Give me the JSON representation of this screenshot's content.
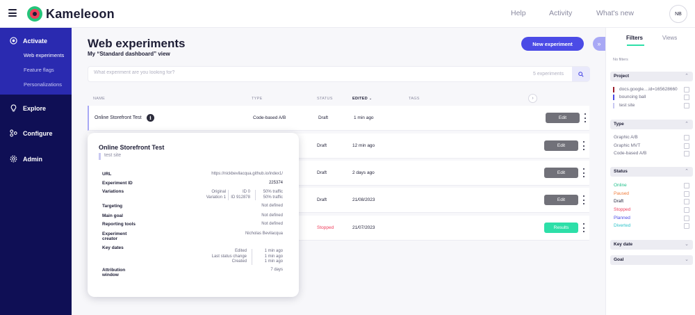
{
  "app": {
    "brand": "Kameleoon",
    "accent": "#4b4be6",
    "green": "#2ddfa8"
  },
  "topbar": {
    "help": "Help",
    "activity": "Activity",
    "whats_new": "What's new",
    "avatar": "NB"
  },
  "sidebar": {
    "activate": "Activate",
    "activate_items": [
      "Web experiments",
      "Feature flags",
      "Personalizations"
    ],
    "explore": "Explore",
    "configure": "Configure",
    "admin": "Admin"
  },
  "main": {
    "title": "Web experiments",
    "subtitle": "My “Standard dashboard” view",
    "new_button": "New experiment",
    "search": {
      "placeholder": "What experiment are you looking for?",
      "count": "5 experiments"
    },
    "columns": {
      "name": "NAME",
      "type": "TYPE",
      "status": "STATUS",
      "edited": "EDITED",
      "tags": "TAGS"
    },
    "rows": [
      {
        "name": "Online Storefront Test",
        "type": "Code-based A/B",
        "status": "Draft",
        "edited": "1 min ago",
        "action": "Edit"
      },
      {
        "name": "",
        "type": "",
        "status": "Draft",
        "edited": "12 min ago",
        "action": "Edit"
      },
      {
        "name": "",
        "type": "",
        "status": "Draft",
        "edited": "2 days ago",
        "action": "Edit"
      },
      {
        "name": "",
        "type": "",
        "status": "Draft",
        "edited": "21/08/2023",
        "action": "Edit"
      },
      {
        "name": "",
        "type": "",
        "status": "Stopped",
        "edited": "21/07/2023",
        "action": "Results"
      }
    ],
    "status_colors": {
      "Draft": "#1d1d35",
      "Stopped": "#ef3d5b"
    }
  },
  "popover": {
    "title": "Online Storefront Test",
    "site": "test site",
    "url_label": "URL",
    "url": "https://nickbevilacqua.github.io/index1/",
    "id_label": "Experiment ID",
    "id": "225374",
    "variations_label": "Variations",
    "variations": [
      {
        "name": "Original",
        "id": "ID 0",
        "traffic": "50% traffic"
      },
      {
        "name": "Variation 1",
        "id": "ID 912878",
        "traffic": "50% traffic"
      }
    ],
    "targeting_label": "Targeting",
    "targeting": "Not defined",
    "main_goal_label": "Main goal",
    "main_goal": "Not defined",
    "reporting_label": "Reporting tools",
    "reporting": "Not defined",
    "creator_label_1": "Experiment",
    "creator_label_2": "creator",
    "creator": "Nicholas Bevilacqua",
    "key_dates_label": "Key dates",
    "key_dates": [
      {
        "label": "Edited",
        "value": "1 min ago"
      },
      {
        "label": "Last status change",
        "value": "1 min ago"
      },
      {
        "label": "Created",
        "value": "1 min ago"
      }
    ],
    "attribution_label_1": "Attribution",
    "attribution_label_2": "window",
    "attribution": "7 days"
  },
  "filters": {
    "tab_filters": "Filters",
    "tab_views": "Views",
    "no_filters": "No filters",
    "project": {
      "title": "Project",
      "options": [
        {
          "label": "docs.google....id=165628660",
          "color": "#9b1d2a"
        },
        {
          "label": "bouncing ball",
          "color": "#4b4be6"
        },
        {
          "label": "test site",
          "color": "#c9c9f2"
        }
      ]
    },
    "type": {
      "title": "Type",
      "options": [
        "Graphic A/B",
        "Graphic MVT",
        "Code-based A/B"
      ]
    },
    "status": {
      "title": "Status",
      "options": [
        {
          "label": "Online",
          "color": "#1fbf8a"
        },
        {
          "label": "Paused",
          "color": "#f07c3a"
        },
        {
          "label": "Draft",
          "color": "#1d1d35"
        },
        {
          "label": "Stopped",
          "color": "#ef3d5b"
        },
        {
          "label": "Planned",
          "color": "#4b4be6"
        },
        {
          "label": "Diverted",
          "color": "#2bc2c9"
        }
      ]
    },
    "key_date": {
      "title": "Key date"
    },
    "goal": {
      "title": "Goal"
    }
  }
}
